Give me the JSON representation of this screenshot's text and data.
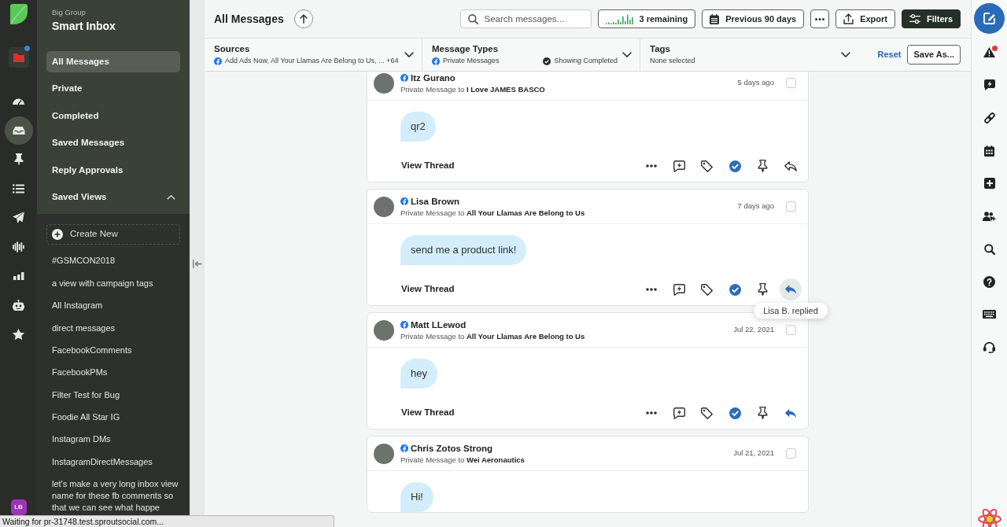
{
  "nav_rail": {
    "workspace": {
      "notification": true
    },
    "items": [
      {
        "selected": false
      },
      {
        "selected": true
      },
      {
        "selected": false
      },
      {
        "selected": false
      },
      {
        "selected": false
      },
      {
        "selected": false
      },
      {
        "selected": false
      },
      {
        "selected": false
      },
      {
        "selected": false
      }
    ],
    "user": {
      "initials": "LB"
    }
  },
  "sidebar": {
    "group": "Big Group",
    "title": "Smart Inbox",
    "items": [
      {
        "label": "All Messages",
        "selected": true
      },
      {
        "label": "Private",
        "selected": false
      },
      {
        "label": "Completed",
        "selected": false
      },
      {
        "label": "Saved Messages",
        "selected": false
      },
      {
        "label": "Reply Approvals",
        "selected": false
      }
    ],
    "saved_views": {
      "label": "Saved Views",
      "expanded": true,
      "create_label": "Create New",
      "items": [
        {
          "label": "#GSMCON2018",
          "selected": false
        },
        {
          "label": "a view with campaign tags",
          "selected": false
        },
        {
          "label": "All Instagram",
          "selected": false
        },
        {
          "label": "direct messages",
          "selected": false
        },
        {
          "label": "FacebookComments",
          "selected": false
        },
        {
          "label": "FacebookPMs",
          "selected": false
        },
        {
          "label": "Filter Test for Bug",
          "selected": false
        },
        {
          "label": "Foodie All Star IG",
          "selected": false
        },
        {
          "label": "Instagram DMs",
          "selected": false
        },
        {
          "label": "InstagramDirectMessages",
          "selected": false
        },
        {
          "label": "let's make a very long inbox view name for these fb comments so that we can see what happe",
          "selected": false
        }
      ]
    }
  },
  "header": {
    "title": "All Messages",
    "search": {
      "placeholder": "Search messages..."
    },
    "remaining": "3 remaining",
    "date_range": "Previous 90 days",
    "export": "Export",
    "filters": "Filters"
  },
  "filter_bar": {
    "filters": [
      {
        "label": "Sources",
        "network_icon": true,
        "summary": "Add Ads Now, All Your Llamas Are Belong to Us, ... +64"
      },
      {
        "label": "Message Types",
        "network_icon": true,
        "summary": "Private Messages",
        "status": "Showing Completed"
      },
      {
        "label": "Tags",
        "network_icon": false,
        "summary": "None selected"
      }
    ],
    "reset": "Reset",
    "save_as": "Save As..."
  },
  "messages": [
    {
      "author": "Itz Gurano",
      "recipient_line": "Private Message to **I Love JAMES BASCO**",
      "time": "5 days ago",
      "selected": false,
      "text": "qr2",
      "action": "View Thread",
      "completed": true,
      "replied": false
    },
    {
      "author": "Lisa Brown",
      "recipient_line": "Private Message to **All Your Llamas Are Belong to Us**",
      "time": "7 days ago",
      "selected": false,
      "text": "send me a product link!",
      "action": "View Thread",
      "completed": true,
      "replied": true,
      "tooltip": "Lisa B. replied"
    },
    {
      "author": "Matt LLewod",
      "recipient_line": "Private Message to **All Your Llamas Are Belong to Us**",
      "time": "Jul 22, 2021",
      "selected": false,
      "text": "hey",
      "action": "View Thread",
      "completed": true,
      "replied": true
    },
    {
      "author": "Chris Zotos Strong",
      "recipient_line": "Private Message to **Wei Aeronautics**",
      "time": "Jul 21, 2021",
      "selected": false,
      "text": "Hi!"
    }
  ],
  "right_rail": {
    "items": [
      {
        "notification": true
      },
      {
        "notification": false
      },
      {
        "notification": false
      },
      {
        "notification": false
      },
      {
        "notification": false
      },
      {
        "notification": false
      },
      {
        "notification": false
      },
      {
        "notification": false
      },
      {
        "notification": false
      },
      {
        "notification": false
      }
    ]
  },
  "status_bar": {
    "text": "Waiting for pr-31748.test.sproutsocial.com..."
  }
}
